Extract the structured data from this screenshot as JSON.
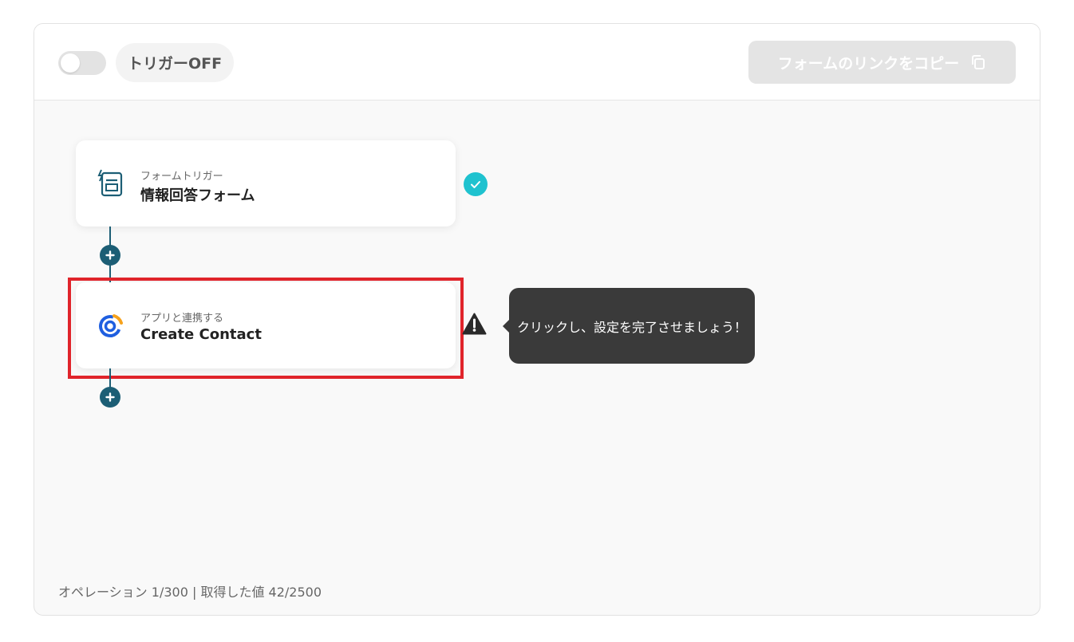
{
  "topbar": {
    "toggle_state": "off",
    "trigger_label": "トリガーOFF",
    "copy_button_label": "フォームのリンクをコピー",
    "copy_icon": "copy-icon"
  },
  "flow": {
    "nodes": [
      {
        "subtitle": "フォームトリガー",
        "title": "情報回答フォーム",
        "icon": "form-icon",
        "status": "complete"
      },
      {
        "subtitle": "アプリと連携する",
        "title": "Create Contact",
        "icon": "app-logo-icon",
        "status": "incomplete"
      }
    ],
    "tooltip": "クリックし、設定を完了させましょう！"
  },
  "footer": {
    "text": "オペレーション 1/300 | 取得した値 42/2500"
  },
  "colors": {
    "accent_teal": "#1c5e75",
    "check_cyan": "#1fc2cf",
    "highlight_red": "#e0242b",
    "tooltip_bg": "#3a3a3a"
  }
}
